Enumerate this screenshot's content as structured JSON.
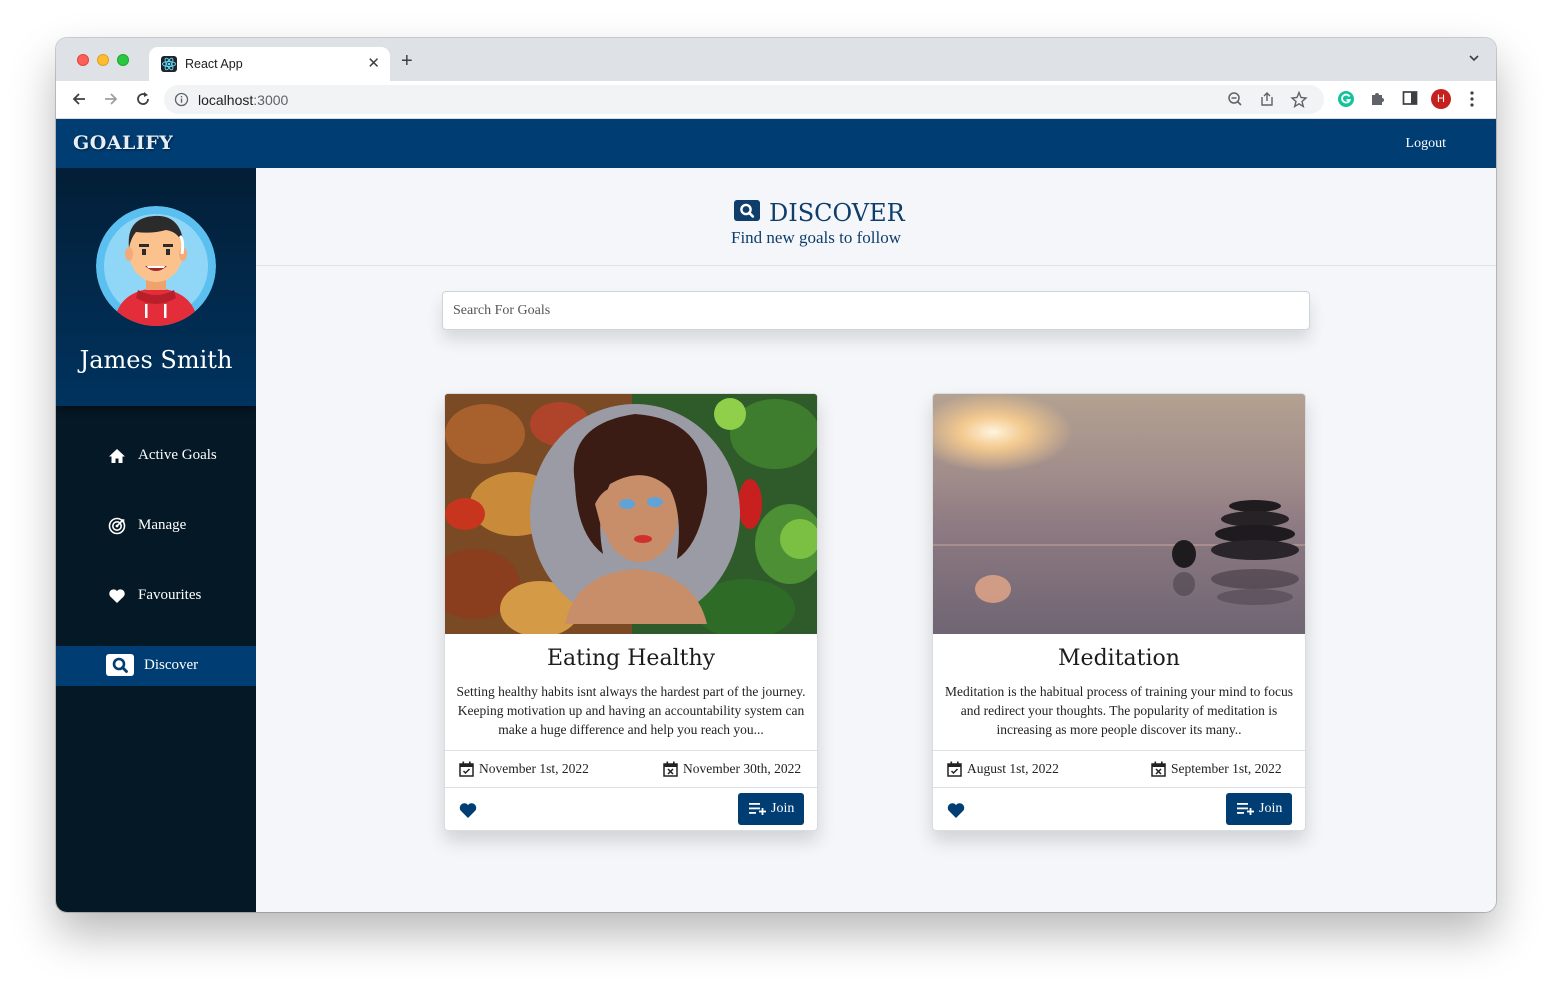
{
  "browser": {
    "tab_title": "React App",
    "url_host": "localhost",
    "url_port": ":3000",
    "profile_initial": "H"
  },
  "app": {
    "brand": "GOALIFY",
    "logout_label": "Logout",
    "accent_color": "#003d73"
  },
  "sidebar": {
    "user_name": "James Smith",
    "items": [
      {
        "label": "Active Goals",
        "icon": "home-icon"
      },
      {
        "label": "Manage",
        "icon": "target-icon"
      },
      {
        "label": "Favourites",
        "icon": "heart-icon"
      },
      {
        "label": "Discover",
        "icon": "search-icon",
        "active": true
      }
    ]
  },
  "discover": {
    "title": "DISCOVER",
    "subtitle": "Find new goals to follow",
    "search_placeholder": "Search For Goals"
  },
  "cards": [
    {
      "title": "Eating Healthy",
      "description": "Setting healthy habits isnt always the hardest part of the journey. Keeping motivation up and having an accountability system can make a huge difference and help you reach you...",
      "start_date": "November 1st, 2022",
      "end_date": "November 30th, 2022",
      "join_label": "Join"
    },
    {
      "title": "Meditation",
      "description": "Meditation is the habitual process of training your mind to focus and redirect your thoughts. The popularity of meditation is increasing as more people discover its many..",
      "start_date": "August 1st, 2022",
      "end_date": "September 1st, 2022",
      "join_label": "Join"
    }
  ]
}
